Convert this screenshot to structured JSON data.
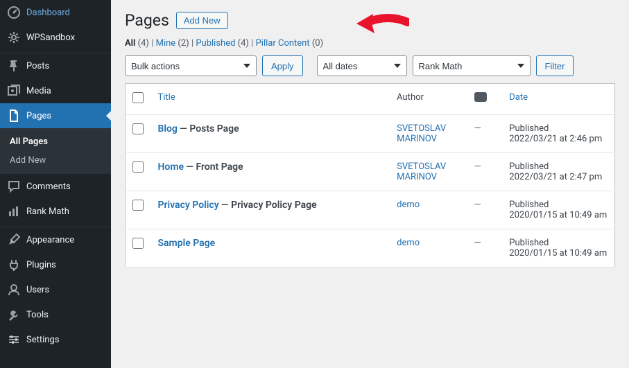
{
  "sidebar": {
    "items": [
      {
        "label": "Dashboard",
        "icon": "dashboard"
      },
      {
        "label": "WPSandbox",
        "icon": "gear"
      },
      {
        "label": "Posts",
        "icon": "pin"
      },
      {
        "label": "Media",
        "icon": "media"
      },
      {
        "label": "Pages",
        "icon": "page",
        "current": true
      },
      {
        "label": "Comments",
        "icon": "comment"
      },
      {
        "label": "Rank Math",
        "icon": "chart"
      },
      {
        "label": "Appearance",
        "icon": "brush"
      },
      {
        "label": "Plugins",
        "icon": "plug"
      },
      {
        "label": "Users",
        "icon": "user"
      },
      {
        "label": "Tools",
        "icon": "wrench"
      },
      {
        "label": "Settings",
        "icon": "sliders"
      }
    ],
    "submenu": [
      {
        "label": "All Pages",
        "current": true
      },
      {
        "label": "Add New"
      }
    ]
  },
  "header": {
    "title": "Pages",
    "add_new": "Add New"
  },
  "filters": {
    "views": [
      {
        "label": "All",
        "count": "(4)",
        "current": true
      },
      {
        "label": "Mine",
        "count": "(2)"
      },
      {
        "label": "Published",
        "count": "(4)"
      },
      {
        "label": "Pillar Content",
        "count": "(0)"
      }
    ],
    "bulk_actions": "Bulk actions",
    "apply": "Apply",
    "all_dates": "All dates",
    "rank_math": "Rank Math",
    "filter": "Filter"
  },
  "table": {
    "columns": {
      "title": "Title",
      "author": "Author",
      "date": "Date"
    },
    "rows": [
      {
        "title": "Blog",
        "state": "Posts Page",
        "author": "SVETOSLAV MARINOV",
        "date_status": "Published",
        "date": "2022/03/21 at 2:46 pm"
      },
      {
        "title": "Home",
        "state": "Front Page",
        "author": "SVETOSLAV MARINOV",
        "date_status": "Published",
        "date": "2022/03/21 at 2:47 pm"
      },
      {
        "title": "Privacy Policy",
        "state": "Privacy Policy Page",
        "author": "demo",
        "date_status": "Published",
        "date": "2020/01/15 at 10:49 am"
      },
      {
        "title": "Sample Page",
        "state": "",
        "author": "demo",
        "date_status": "Published",
        "date": "2020/01/15 at 10:49 am"
      }
    ]
  }
}
